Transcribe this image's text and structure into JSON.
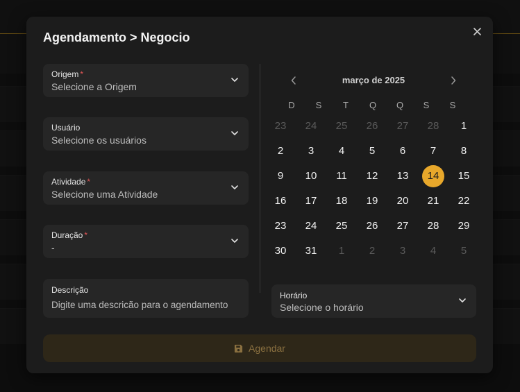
{
  "modal": {
    "title": "Agendamento > Negocio",
    "close_icon": "close-icon"
  },
  "form": {
    "origem": {
      "label": "Origem",
      "required": "*",
      "value": "Selecione a Origem"
    },
    "usuario": {
      "label": "Usuário",
      "value": "Selecione os usuários"
    },
    "atividade": {
      "label": "Atividade",
      "required": "*",
      "value": "Selecione uma Atividade"
    },
    "duracao": {
      "label": "Duração",
      "required": "*",
      "value": "-"
    },
    "descricao": {
      "label": "Descrição",
      "placeholder": "Digite uma descricão para o agendamento"
    }
  },
  "calendar": {
    "month_label": "março de 2025",
    "weekdays": [
      "D",
      "S",
      "T",
      "Q",
      "Q",
      "S",
      "S"
    ],
    "weeks": [
      [
        "23",
        "24",
        "25",
        "26",
        "27",
        "28",
        "1"
      ],
      [
        "2",
        "3",
        "4",
        "5",
        "6",
        "7",
        "8"
      ],
      [
        "9",
        "10",
        "11",
        "12",
        "13",
        "14",
        "15"
      ],
      [
        "16",
        "17",
        "18",
        "19",
        "20",
        "21",
        "22"
      ],
      [
        "23",
        "24",
        "25",
        "26",
        "27",
        "28",
        "29"
      ],
      [
        "30",
        "31",
        "1",
        "2",
        "3",
        "4",
        "5"
      ]
    ],
    "selected_day": "14",
    "accent_color": "#e8a82b"
  },
  "horario": {
    "label": "Horário",
    "value": "Selecione o horário"
  },
  "submit": {
    "label": "Agendar",
    "icon": "save-icon"
  }
}
